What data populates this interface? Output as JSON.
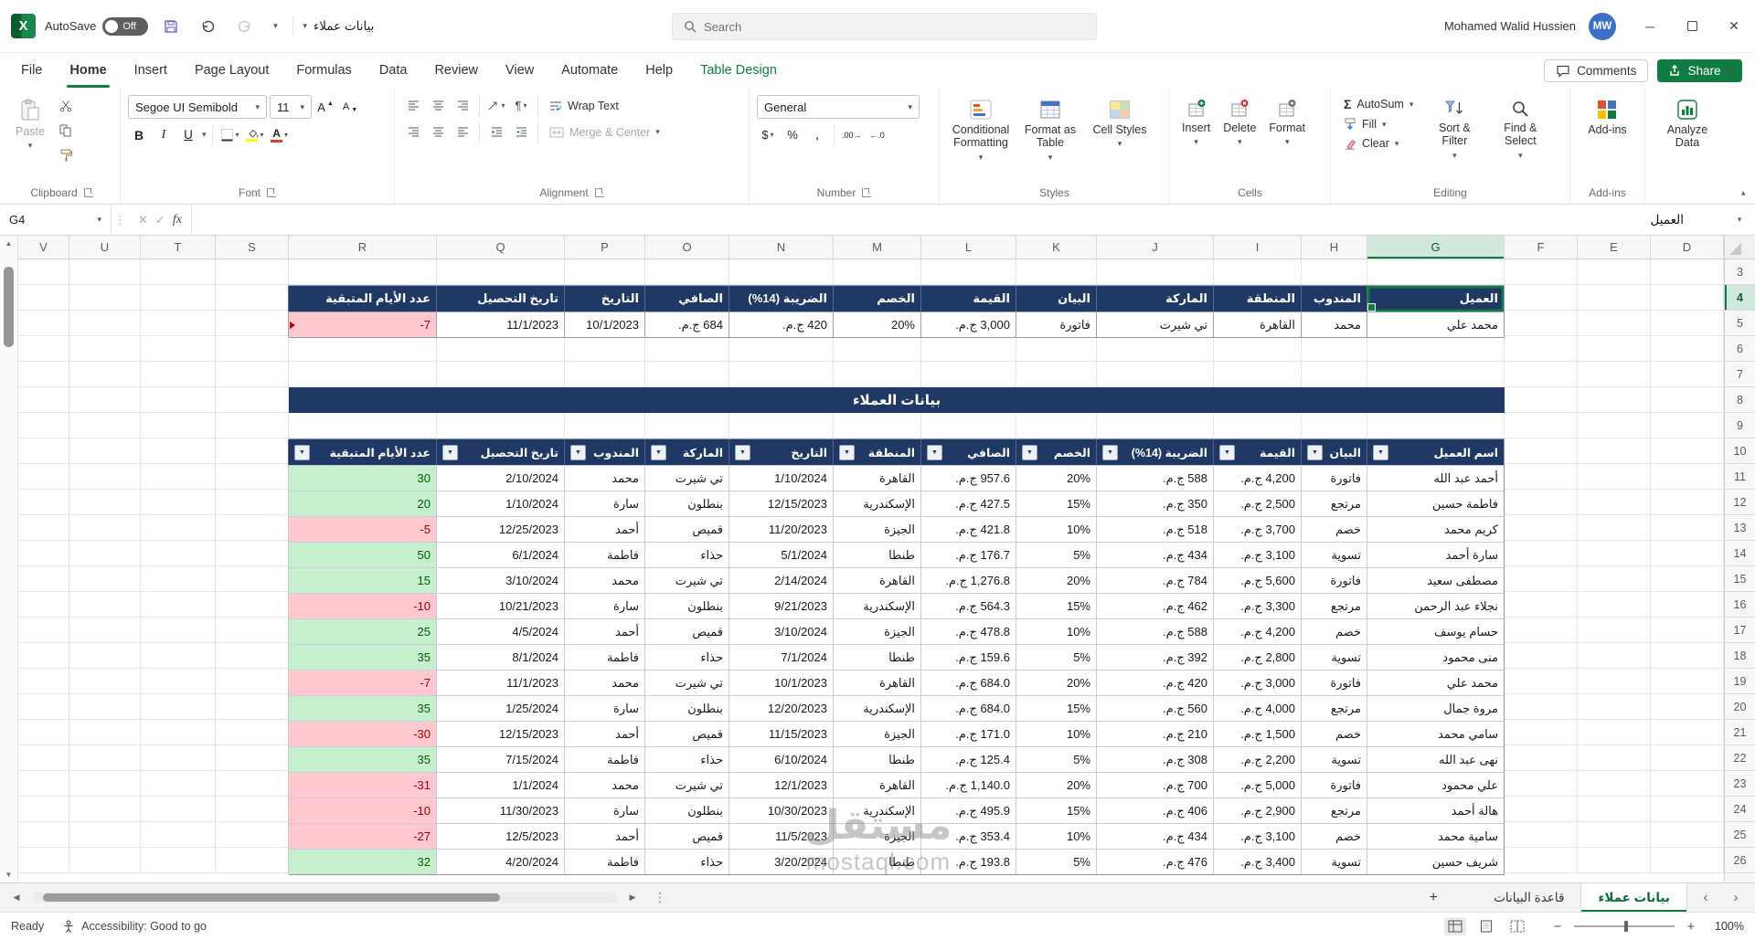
{
  "titlebar": {
    "autosave_label": "AutoSave",
    "autosave_state": "Off",
    "file_name": "بيانات عملاء",
    "search_placeholder": "Search",
    "user_name": "Mohamed Walid Hussien",
    "user_initials": "MW"
  },
  "ribbon_tabs": [
    {
      "label": "File"
    },
    {
      "label": "Home",
      "active": true
    },
    {
      "label": "Insert"
    },
    {
      "label": "Page Layout"
    },
    {
      "label": "Formulas"
    },
    {
      "label": "Data"
    },
    {
      "label": "Review"
    },
    {
      "label": "View"
    },
    {
      "label": "Automate"
    },
    {
      "label": "Help"
    },
    {
      "label": "Table Design",
      "contextual": true
    }
  ],
  "top_actions": {
    "comments": "Comments",
    "share": "Share"
  },
  "ribbon": {
    "clipboard": {
      "label": "Clipboard",
      "paste": "Paste"
    },
    "font": {
      "label": "Font",
      "name": "Segoe UI Semibold",
      "size": "11",
      "bold": "B",
      "italic": "I",
      "underline": "U"
    },
    "alignment": {
      "label": "Alignment",
      "wrap": "Wrap Text",
      "merge": "Merge & Center"
    },
    "number": {
      "label": "Number",
      "format": "General",
      "currency": "$",
      "percent": "%",
      "comma": ",",
      "inc_decimal": ".00→",
      "dec_decimal": "←.0"
    },
    "styles": {
      "label": "Styles",
      "conditional": "Conditional Formatting",
      "format_table": "Format as Table",
      "cell_styles": "Cell Styles"
    },
    "cells": {
      "label": "Cells",
      "insert": "Insert",
      "delete": "Delete",
      "format": "Format"
    },
    "editing": {
      "label": "Editing",
      "autosum": "AutoSum",
      "fill": "Fill",
      "clear": "Clear",
      "sort": "Sort & Filter",
      "find": "Find & Select"
    },
    "addins": {
      "label": "Add-ins",
      "button": "Add-ins"
    },
    "analyze": {
      "label": "Analyze Data"
    }
  },
  "formula_bar": {
    "name_box": "G4",
    "fx": "fx",
    "value": "العميل"
  },
  "sheet": {
    "columns": [
      "V",
      "U",
      "T",
      "S",
      "R",
      "Q",
      "P",
      "O",
      "N",
      "M",
      "L",
      "K",
      "J",
      "I",
      "H",
      "G",
      "F",
      "E",
      "D"
    ],
    "selected_column": "G",
    "row_start": 3,
    "row_end": 26,
    "selected_row": 4,
    "selected_cell": "G4",
    "summary_table": {
      "headers": [
        "العميل",
        "المندوب",
        "المنطقة",
        "الماركة",
        "البيان",
        "القيمة",
        "الخصم",
        "الضريبة (14%)",
        "الصافي",
        "التاريخ",
        "تاريخ التحصيل",
        "عدد الأيام المتبقية"
      ],
      "types": [
        "text",
        "text",
        "text",
        "text",
        "text",
        "currency",
        "percent",
        "currency",
        "currency",
        "date",
        "date",
        "days"
      ],
      "row": [
        "محمد علي",
        "محمد",
        "القاهرة",
        "تي شيرت",
        "فاتورة",
        "3,000 ج.م.",
        "20%",
        "420 ج.م.",
        "684 ج.م.",
        "10/1/2023",
        "11/1/2023",
        -7
      ]
    },
    "section_title": "بيانات العملاء",
    "main_table": {
      "headers": [
        "اسم العميل",
        "البيان",
        "القيمة",
        "الضريبة (14%)",
        "الخصم",
        "الصافي",
        "المنطقة",
        "التاريخ",
        "الماركة",
        "المندوب",
        "تاريخ التحصيل",
        "عدد الأيام المتبقية"
      ],
      "types": [
        "text",
        "text",
        "currency",
        "currency",
        "percent",
        "currency",
        "text",
        "date",
        "text",
        "text",
        "date",
        "days"
      ],
      "rows": [
        [
          "أحمد عبد الله",
          "فاتورة",
          "4,200 ج.م.",
          "588 ج.م.",
          "20%",
          "957.6 ج.م.",
          "القاهرة",
          "1/10/2024",
          "تي شيرت",
          "محمد",
          "2/10/2024",
          30
        ],
        [
          "فاطمة حسين",
          "مرتجع",
          "2,500 ج.م.",
          "350 ج.م.",
          "15%",
          "427.5 ج.م.",
          "الإسكندرية",
          "12/15/2023",
          "بنطلون",
          "سارة",
          "1/10/2024",
          20
        ],
        [
          "كريم محمد",
          "خصم",
          "3,700 ج.م.",
          "518 ج.م.",
          "10%",
          "421.8 ج.م.",
          "الجيزة",
          "11/20/2023",
          "قميص",
          "أحمد",
          "12/25/2023",
          -5
        ],
        [
          "سارة أحمد",
          "تسوية",
          "3,100 ج.م.",
          "434 ج.م.",
          "5%",
          "176.7 ج.م.",
          "طنطا",
          "5/1/2024",
          "حذاء",
          "فاطمة",
          "6/1/2024",
          50
        ],
        [
          "مصطفى سعيد",
          "فاتورة",
          "5,600 ج.م.",
          "784 ج.م.",
          "20%",
          "1,276.8 ج.م.",
          "القاهرة",
          "2/14/2024",
          "تي شيرت",
          "محمد",
          "3/10/2024",
          15
        ],
        [
          "نجلاء عبد الرحمن",
          "مرتجع",
          "3,300 ج.م.",
          "462 ج.م.",
          "15%",
          "564.3 ج.م.",
          "الإسكندرية",
          "9/21/2023",
          "بنطلون",
          "سارة",
          "10/21/2023",
          -10
        ],
        [
          "حسام يوسف",
          "خصم",
          "4,200 ج.م.",
          "588 ج.م.",
          "10%",
          "478.8 ج.م.",
          "الجيزة",
          "3/10/2024",
          "قميص",
          "أحمد",
          "4/5/2024",
          25
        ],
        [
          "منى محمود",
          "تسوية",
          "2,800 ج.م.",
          "392 ج.م.",
          "5%",
          "159.6 ج.م.",
          "طنطا",
          "7/1/2024",
          "حذاء",
          "فاطمة",
          "8/1/2024",
          35
        ],
        [
          "محمد علي",
          "فاتورة",
          "3,000 ج.م.",
          "420 ج.م.",
          "20%",
          "684.0 ج.م.",
          "القاهرة",
          "10/1/2023",
          "تي شيرت",
          "محمد",
          "11/1/2023",
          -7
        ],
        [
          "مروة جمال",
          "مرتجع",
          "4,000 ج.م.",
          "560 ج.م.",
          "15%",
          "684.0 ج.م.",
          "الإسكندرية",
          "12/20/2023",
          "بنطلون",
          "سارة",
          "1/25/2024",
          35
        ],
        [
          "سامي محمد",
          "خصم",
          "1,500 ج.م.",
          "210 ج.م.",
          "10%",
          "171.0 ج.م.",
          "الجيزة",
          "11/15/2023",
          "قميص",
          "أحمد",
          "12/15/2023",
          -30
        ],
        [
          "نهى عبد الله",
          "تسوية",
          "2,200 ج.م.",
          "308 ج.م.",
          "5%",
          "125.4 ج.م.",
          "طنطا",
          "6/10/2024",
          "حذاء",
          "فاطمة",
          "7/15/2024",
          35
        ],
        [
          "علي محمود",
          "فاتورة",
          "5,000 ج.م.",
          "700 ج.م.",
          "20%",
          "1,140.0 ج.م.",
          "القاهرة",
          "12/1/2023",
          "تي شيرت",
          "محمد",
          "1/1/2024",
          -31
        ],
        [
          "هالة أحمد",
          "مرتجع",
          "2,900 ج.م.",
          "406 ج.م.",
          "15%",
          "495.9 ج.م.",
          "الإسكندرية",
          "10/30/2023",
          "بنطلون",
          "سارة",
          "11/30/2023",
          -10
        ],
        [
          "سامية محمد",
          "خصم",
          "3,100 ج.م.",
          "434 ج.م.",
          "10%",
          "353.4 ج.م.",
          "الجيزة",
          "11/5/2023",
          "قميص",
          "أحمد",
          "12/5/2023",
          -27
        ],
        [
          "شريف حسين",
          "تسوية",
          "3,400 ج.م.",
          "476 ج.م.",
          "5%",
          "193.8 ج.م.",
          "طنطا",
          "3/20/2024",
          "حذاء",
          "فاطمة",
          "4/20/2024",
          32
        ]
      ]
    },
    "colors": {
      "header_bg": "#1F3864",
      "positive_bg": "#C6EFCE",
      "positive_text": "#006100",
      "negative_bg": "#FFC7CE",
      "negative_text": "#9C0006",
      "selection": "#107C41"
    }
  },
  "watermark": {
    "line1": "مستقل",
    "line2": "mostaql.com"
  },
  "sheet_tabs": [
    {
      "label": "قاعدة البيانات"
    },
    {
      "label": "بيانات عملاء",
      "active": true
    }
  ],
  "status_bar": {
    "ready": "Ready",
    "accessibility": "Accessibility: Good to go",
    "zoom": "100%"
  }
}
